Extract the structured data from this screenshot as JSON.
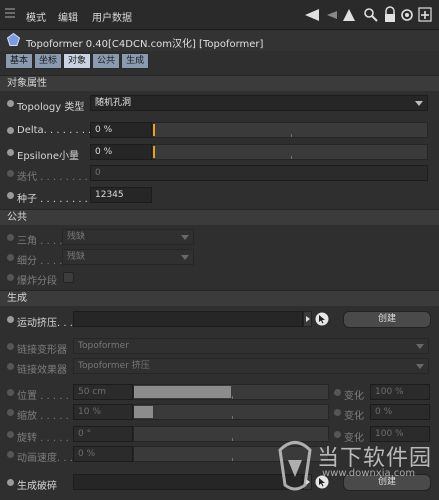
{
  "menubar": {
    "items": [
      "模式",
      "编辑",
      "用户数据"
    ],
    "icons": [
      "back-arrow-icon",
      "up-arrow-icon",
      "search-icon",
      "lock-icon",
      "settings-icon",
      "add-icon"
    ]
  },
  "title": "Topoformer 0.40[C4DCN.com汉化] [Topoformer]",
  "tabs": [
    {
      "label": "基本",
      "active": false
    },
    {
      "label": "坐标",
      "active": false
    },
    {
      "label": "对象",
      "active": true
    },
    {
      "label": "公共",
      "active": false
    },
    {
      "label": "生成",
      "active": false
    }
  ],
  "object_props": {
    "header": "对象属性",
    "topology_label": "Topology 类型",
    "topology_value": "随机孔洞",
    "delta_label": "Delta. . . . . . . . .",
    "delta_value": "0 %",
    "epsilon_label": "Epsilone小量",
    "epsilon_value": "0 %",
    "iter_label": "迭代 . . . . . . . .",
    "iter_value": "0",
    "seed_label": "种子 . . . . . . . .",
    "seed_value": "12345"
  },
  "common": {
    "header": "公共",
    "triangle_label": "三角 . . . .",
    "triangle_value": "残缺",
    "subdiv_label": "细分 . . . .",
    "subdiv_value": "残缺",
    "explode_label": "爆炸分段"
  },
  "generate": {
    "header": "生成",
    "motion_label": "运动挤压. . . . .",
    "create_label": "创建",
    "link_deformer_label": "链接变形器",
    "link_deformer_value": "Topoformer",
    "link_effector_label": "链接效果器",
    "link_effector_value": "Topoformer 挤压",
    "position_label": "位置 . . . . . .",
    "position_value": "50 cm",
    "position_fill": 0.5,
    "scale_label": "缩放 . . . . . .",
    "scale_value": "10 %",
    "scale_fill": 0.1,
    "rotate_label": "旋转 . . . . . .",
    "rotate_value": "0 °",
    "anim_label": "动画速度. . . .",
    "anim_value": "0 %",
    "vary_label": "变化",
    "vary_values": [
      "100 %",
      "0 %",
      "100 %"
    ],
    "gen_break_label": "生成破碎",
    "create2_label": "创建"
  },
  "watermark": {
    "text": "当下软件园",
    "url": "www.downxia.com"
  }
}
